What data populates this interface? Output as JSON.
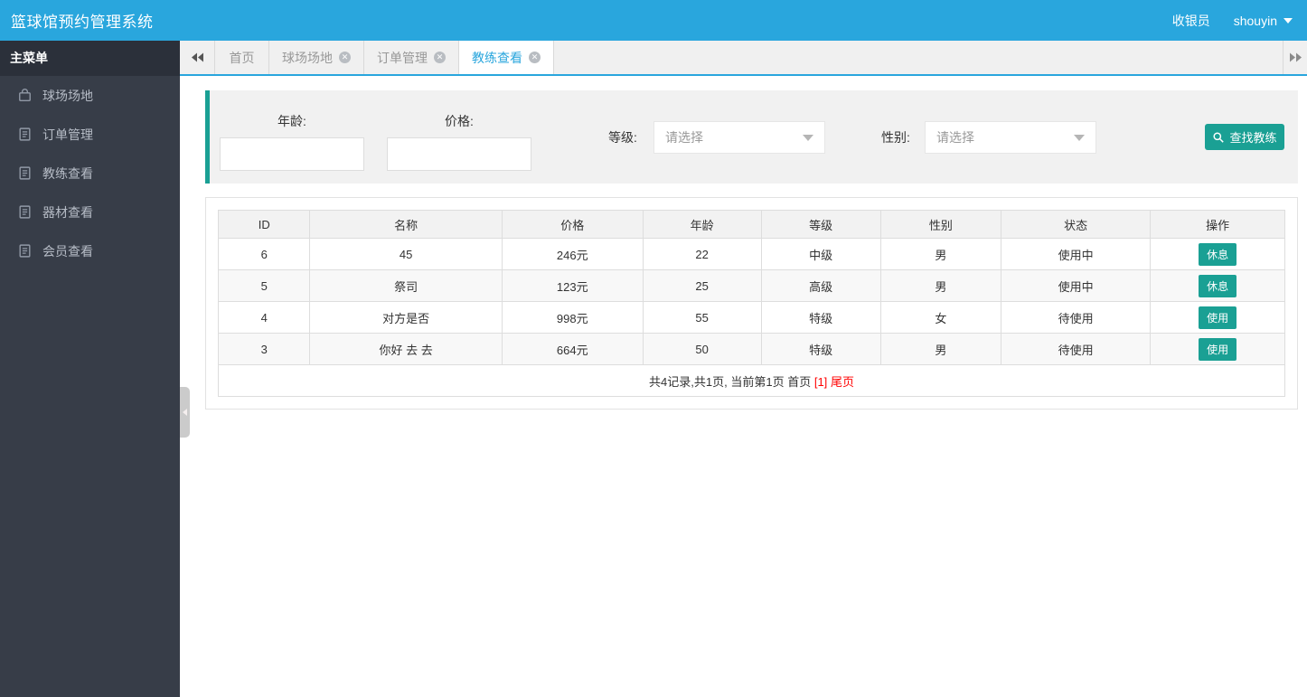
{
  "header": {
    "title": "篮球馆预约管理系统",
    "role": "收银员",
    "username": "shouyin"
  },
  "sidebar": {
    "title": "主菜单",
    "items": [
      {
        "label": "球场场地",
        "icon": "bag-icon"
      },
      {
        "label": "订单管理",
        "icon": "file-text-icon"
      },
      {
        "label": "教练查看",
        "icon": "file-text-icon"
      },
      {
        "label": "器材查看",
        "icon": "file-text-icon"
      },
      {
        "label": "会员查看",
        "icon": "file-text-icon"
      }
    ]
  },
  "tabs": [
    {
      "label": "首页",
      "closable": false,
      "active": false
    },
    {
      "label": "球场场地",
      "closable": true,
      "active": false
    },
    {
      "label": "订单管理",
      "closable": true,
      "active": false
    },
    {
      "label": "教练查看",
      "closable": true,
      "active": true
    }
  ],
  "filter": {
    "age_label": "年龄:",
    "price_label": "价格:",
    "level_label": "等级:",
    "gender_label": "性别:",
    "level_placeholder": "请选择",
    "gender_placeholder": "请选择",
    "search_button": "查找教练"
  },
  "table": {
    "columns": [
      "ID",
      "名称",
      "价格",
      "年龄",
      "等级",
      "性别",
      "状态",
      "操作"
    ],
    "rows": [
      {
        "id": "6",
        "name": "45",
        "price": "246元",
        "age": "22",
        "level": "中级",
        "gender": "男",
        "status": "使用中",
        "action": "休息"
      },
      {
        "id": "5",
        "name": "祭司",
        "price": "123元",
        "age": "25",
        "level": "高级",
        "gender": "男",
        "status": "使用中",
        "action": "休息"
      },
      {
        "id": "4",
        "name": "对方是否",
        "price": "998元",
        "age": "55",
        "level": "特级",
        "gender": "女",
        "status": "待使用",
        "action": "使用"
      },
      {
        "id": "3",
        "name": "你好 去 去",
        "price": "664元",
        "age": "50",
        "level": "特级",
        "gender": "男",
        "status": "待使用",
        "action": "使用"
      }
    ],
    "pagination": {
      "summary": "共4记录,共1页, 当前第1页",
      "first": "首页",
      "current": "[1]",
      "last": "尾页"
    }
  },
  "colors": {
    "header_blue": "#29a6dd",
    "teal_accent": "#1aa094",
    "sidebar_dark": "#373d48",
    "pagination_red": "#ff0000"
  }
}
